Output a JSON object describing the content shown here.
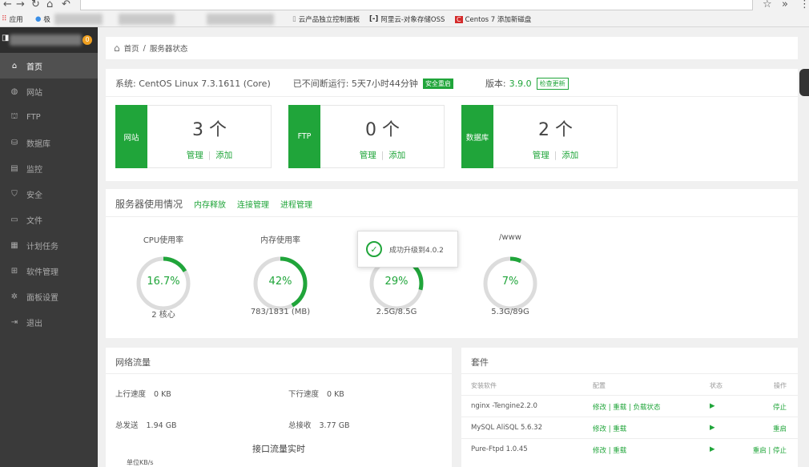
{
  "browser": {
    "bookmarks": [
      {
        "label": "应用",
        "icon": "apps-grid-icon"
      },
      {
        "label": "云产品独立控制面板",
        "icon": "page-icon"
      },
      {
        "label": "阿里云-对象存储OSS",
        "icon": "aliyun-icon"
      },
      {
        "label": "Centos 7 添加新磁盘",
        "icon": "c-logo-icon"
      }
    ],
    "bookmark_partial": "极"
  },
  "sidebar": {
    "badge": "0",
    "items": [
      {
        "label": "首页",
        "icon": "home-icon",
        "active": true
      },
      {
        "label": "网站",
        "icon": "globe-icon"
      },
      {
        "label": "FTP",
        "icon": "ftp-icon"
      },
      {
        "label": "数据库",
        "icon": "database-icon"
      },
      {
        "label": "监控",
        "icon": "monitor-icon"
      },
      {
        "label": "安全",
        "icon": "shield-icon"
      },
      {
        "label": "文件",
        "icon": "folder-icon"
      },
      {
        "label": "计划任务",
        "icon": "calendar-icon"
      },
      {
        "label": "软件管理",
        "icon": "apps-icon"
      },
      {
        "label": "面板设置",
        "icon": "gear-icon"
      },
      {
        "label": "退出",
        "icon": "logout-icon"
      }
    ]
  },
  "breadcrumb": {
    "home": "首页",
    "sep": "/",
    "current": "服务器状态"
  },
  "system": {
    "os_label": "系统: CentOS Linux 7.3.1611 (Core)",
    "uptime_label": "已不间断运行: 5天7小时44分钟",
    "restart_tag": "安全重启",
    "version_label": "版本:",
    "version": "3.9.0",
    "update_tag": "检查更新"
  },
  "stats": [
    {
      "label": "网站",
      "count": "3 个",
      "manage": "管理",
      "sep": "|",
      "add": "添加"
    },
    {
      "label": "FTP",
      "count": "0 个",
      "manage": "管理",
      "sep": "|",
      "add": "添加"
    },
    {
      "label": "数据库",
      "count": "2 个",
      "manage": "管理",
      "sep": "|",
      "add": "添加"
    }
  ],
  "usage": {
    "title": "服务器使用情况",
    "links": [
      "内存释放",
      "连接管理",
      "进程管理"
    ],
    "gauges": [
      {
        "label": "CPU使用率",
        "value_text": "16.7%",
        "percent": 16.7,
        "sub": "2 核心"
      },
      {
        "label": "内存使用率",
        "value_text": "42%",
        "percent": 42,
        "sub": "783/1831 (MB)"
      },
      {
        "label": "",
        "value_text": "29%",
        "percent": 29,
        "sub": "2.5G/8.5G"
      },
      {
        "label": "/www",
        "value_text": "7%",
        "percent": 7,
        "sub": "5.3G/89G"
      }
    ],
    "toast": "成功升级到4.0.2"
  },
  "network": {
    "title": "网络流量",
    "up_label": "上行速度",
    "up_value": "0 KB",
    "down_label": "下行速度",
    "down_value": "0 KB",
    "sent_label": "总发送",
    "sent_value": "1.94 GB",
    "recv_label": "总接收",
    "recv_value": "3.77 GB",
    "chart_title": "接口流量实时",
    "unit": "单位KB/s"
  },
  "software": {
    "title": "套件",
    "headers": [
      "安装软件",
      "配置",
      "状态",
      "操作"
    ],
    "rows": [
      {
        "name": "nginx -Tengine2.2.0",
        "config": "修改 | 重载 | 负载状态",
        "status": "▶",
        "ops": "停止"
      },
      {
        "name": "MySQL AliSQL 5.6.32",
        "config": "修改 | 重载",
        "status": "▶",
        "ops": "重启"
      },
      {
        "name": "Pure-Ftpd 1.0.45",
        "config": "修改 | 重载",
        "status": "▶",
        "ops": "重启 | 停止"
      }
    ]
  },
  "colors": {
    "accent": "#20a53a",
    "sidebar": "#3a3a3a",
    "ring_track": "#dcdcdc"
  }
}
